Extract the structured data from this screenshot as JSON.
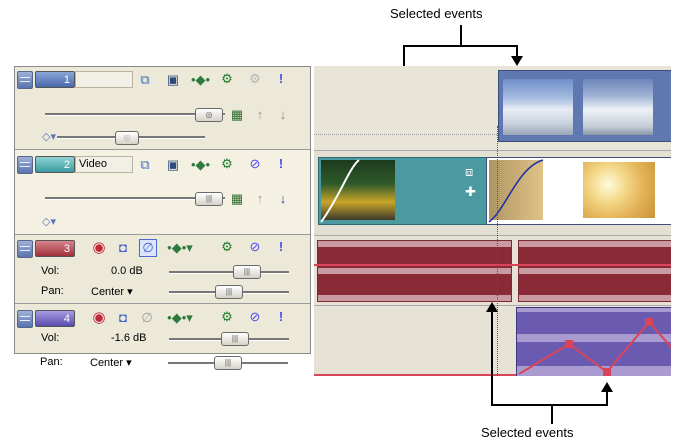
{
  "captions": {
    "top": "Selected events",
    "bottom": "Selected events"
  },
  "colors": {
    "accent": "#5b79b6",
    "audio_clip": "#8a2a37",
    "envelope": "#d9445a"
  },
  "tracks": [
    {
      "number": "1",
      "name": "",
      "type": "video",
      "color": "#5b79b6"
    },
    {
      "number": "2",
      "name": "Video",
      "type": "video",
      "color": "#4aa4a8"
    },
    {
      "number": "3",
      "type": "audio",
      "color": "#a4343e",
      "vol_label": "Vol:",
      "vol_value": "0.0 dB",
      "pan_label": "Pan:",
      "pan_value": "Center"
    },
    {
      "number": "4",
      "type": "audio",
      "color": "#6a5bb0",
      "vol_label": "Vol:",
      "vol_value": "-1.6 dB",
      "pan_label": "Pan:",
      "pan_value": "Center"
    }
  ],
  "icons": {
    "mute": "!",
    "solo": "⊘",
    "fx": "⚙",
    "arm": "◉",
    "dropdown": "▾"
  }
}
